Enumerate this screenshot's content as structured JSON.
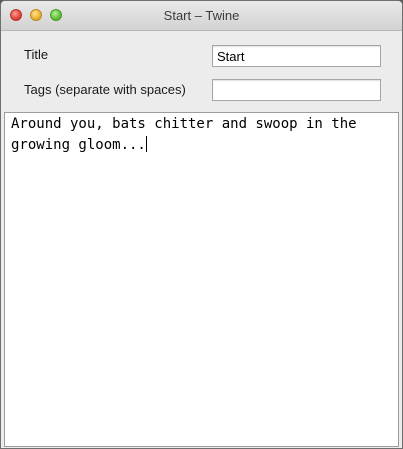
{
  "window": {
    "title": "Start – Twine"
  },
  "passage": {
    "title_label": "Title",
    "title_value": "Start",
    "tags_label": "Tags (separate with spaces)",
    "tags_value": "",
    "body_text": "Around you, bats chitter and swoop in the growing gloom..."
  }
}
